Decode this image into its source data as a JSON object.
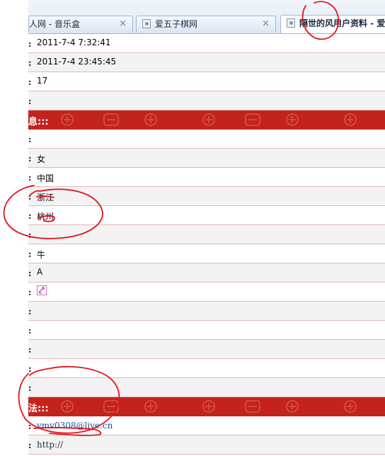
{
  "tabs": [
    {
      "label": "人网 - 音乐盒",
      "close": "×"
    },
    {
      "label": "爱五子棋网",
      "close": "×"
    },
    {
      "label": "隔世的风用户资料 - 爱"
    }
  ],
  "colon": ":",
  "rows": {
    "r1": "2011-7-4 7:32:41",
    "r2": "2011-7-4 23:45:45",
    "r3": "17",
    "r4": "",
    "s1": "息:::",
    "r5": "",
    "r6": "女",
    "r7": "中国",
    "r8": "浙江",
    "r9": "杭州",
    "r10": "",
    "r11": "牛",
    "r12": "A",
    "r14": "",
    "r15": "",
    "r16": "",
    "r17": "",
    "r18": "",
    "s2": "法:::",
    "r19": "vmv0308@live.cn",
    "r20": "http://"
  },
  "icons": {
    "favicon": "page-icon",
    "broken_image": "broken-image-icon",
    "motif": "seal-motif-icon"
  },
  "colors": {
    "section_bg": "#c2241d",
    "row_alt": "#f3f3f3",
    "divider": "#e3b8b8",
    "annotation": "#e3121b",
    "link": "#1a4da0"
  }
}
